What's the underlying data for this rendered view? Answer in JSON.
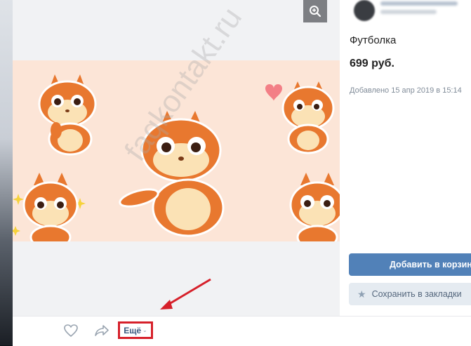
{
  "product": {
    "title": "Футболка",
    "price": "699 руб.",
    "added": "Добавлено 15 апр 2019 в 15:14"
  },
  "actions": {
    "add_to_cart": "Добавить в корзину",
    "bookmark": "Сохранить в закладки",
    "more": "Ещё",
    "more_chevron": "⌄"
  },
  "icons": {
    "zoom": "zoom-in-icon",
    "like": "heart-icon",
    "share": "share-arrow-icon",
    "bookmark": "star-icon"
  },
  "watermark": "faqkontakt.ru",
  "colors": {
    "accent": "#5181b8",
    "annotation": "#d6202a",
    "sticker_bg": "#fce5d7",
    "squirrel": "#e8782f"
  }
}
